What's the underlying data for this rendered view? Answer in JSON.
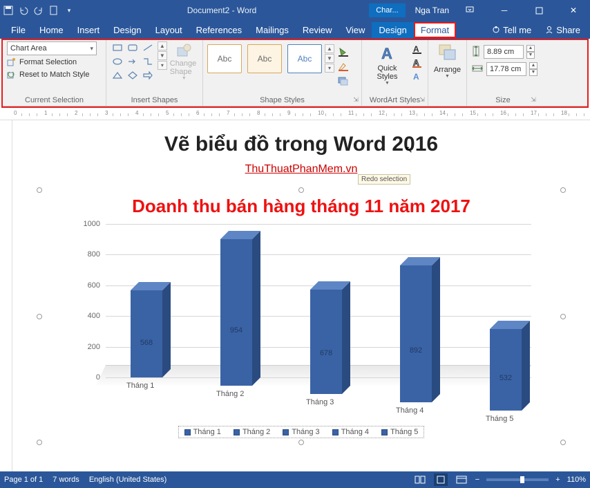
{
  "window": {
    "title": "Document2 - Word",
    "contextual_tab": "Char...",
    "user": "Nga Tran"
  },
  "tabs": [
    "File",
    "Home",
    "Insert",
    "Design",
    "Layout",
    "References",
    "Mailings",
    "Review",
    "View"
  ],
  "context_tabs": [
    "Design",
    "Format"
  ],
  "active_tab": "Format",
  "tellme": "Tell me",
  "share": "Share",
  "ribbon": {
    "current_selection": {
      "label": "Current Selection",
      "dropdown": "Chart Area",
      "format_selection": "Format Selection",
      "reset": "Reset to Match Style"
    },
    "insert_shapes": {
      "label": "Insert Shapes",
      "change_shape": "Change Shape"
    },
    "shape_styles": {
      "label": "Shape Styles",
      "abc": "Abc"
    },
    "wordart_styles": {
      "label": "WordArt Styles",
      "quick_styles": "Quick Styles"
    },
    "arrange": {
      "label": "Arrange",
      "btn": "Arrange"
    },
    "size": {
      "label": "Size",
      "height": "8.89 cm",
      "width": "17.78 cm"
    }
  },
  "document": {
    "heading": "Vẽ biểu đồ trong Word 2016",
    "link": "ThuThuatPhanMem.vn",
    "tooltip": "Redo selection"
  },
  "chart_data": {
    "type": "bar",
    "title": "Doanh thu bán hàng tháng 11 năm 2017",
    "categories": [
      "Tháng 1",
      "Tháng 2",
      "Tháng 3",
      "Tháng 4",
      "Tháng 5"
    ],
    "legend_labels": [
      "Tháng 1",
      "Tháng 2",
      "Tháng 3",
      "Tháng 4",
      "Tháng 5"
    ],
    "values": [
      568,
      954,
      678,
      892,
      532
    ],
    "ymax": 1000,
    "ystep": 200,
    "ylabel": "",
    "xlabel": ""
  },
  "status": {
    "page": "Page 1 of 1",
    "words": "7 words",
    "lang": "English (United States)",
    "zoom": "110%"
  }
}
